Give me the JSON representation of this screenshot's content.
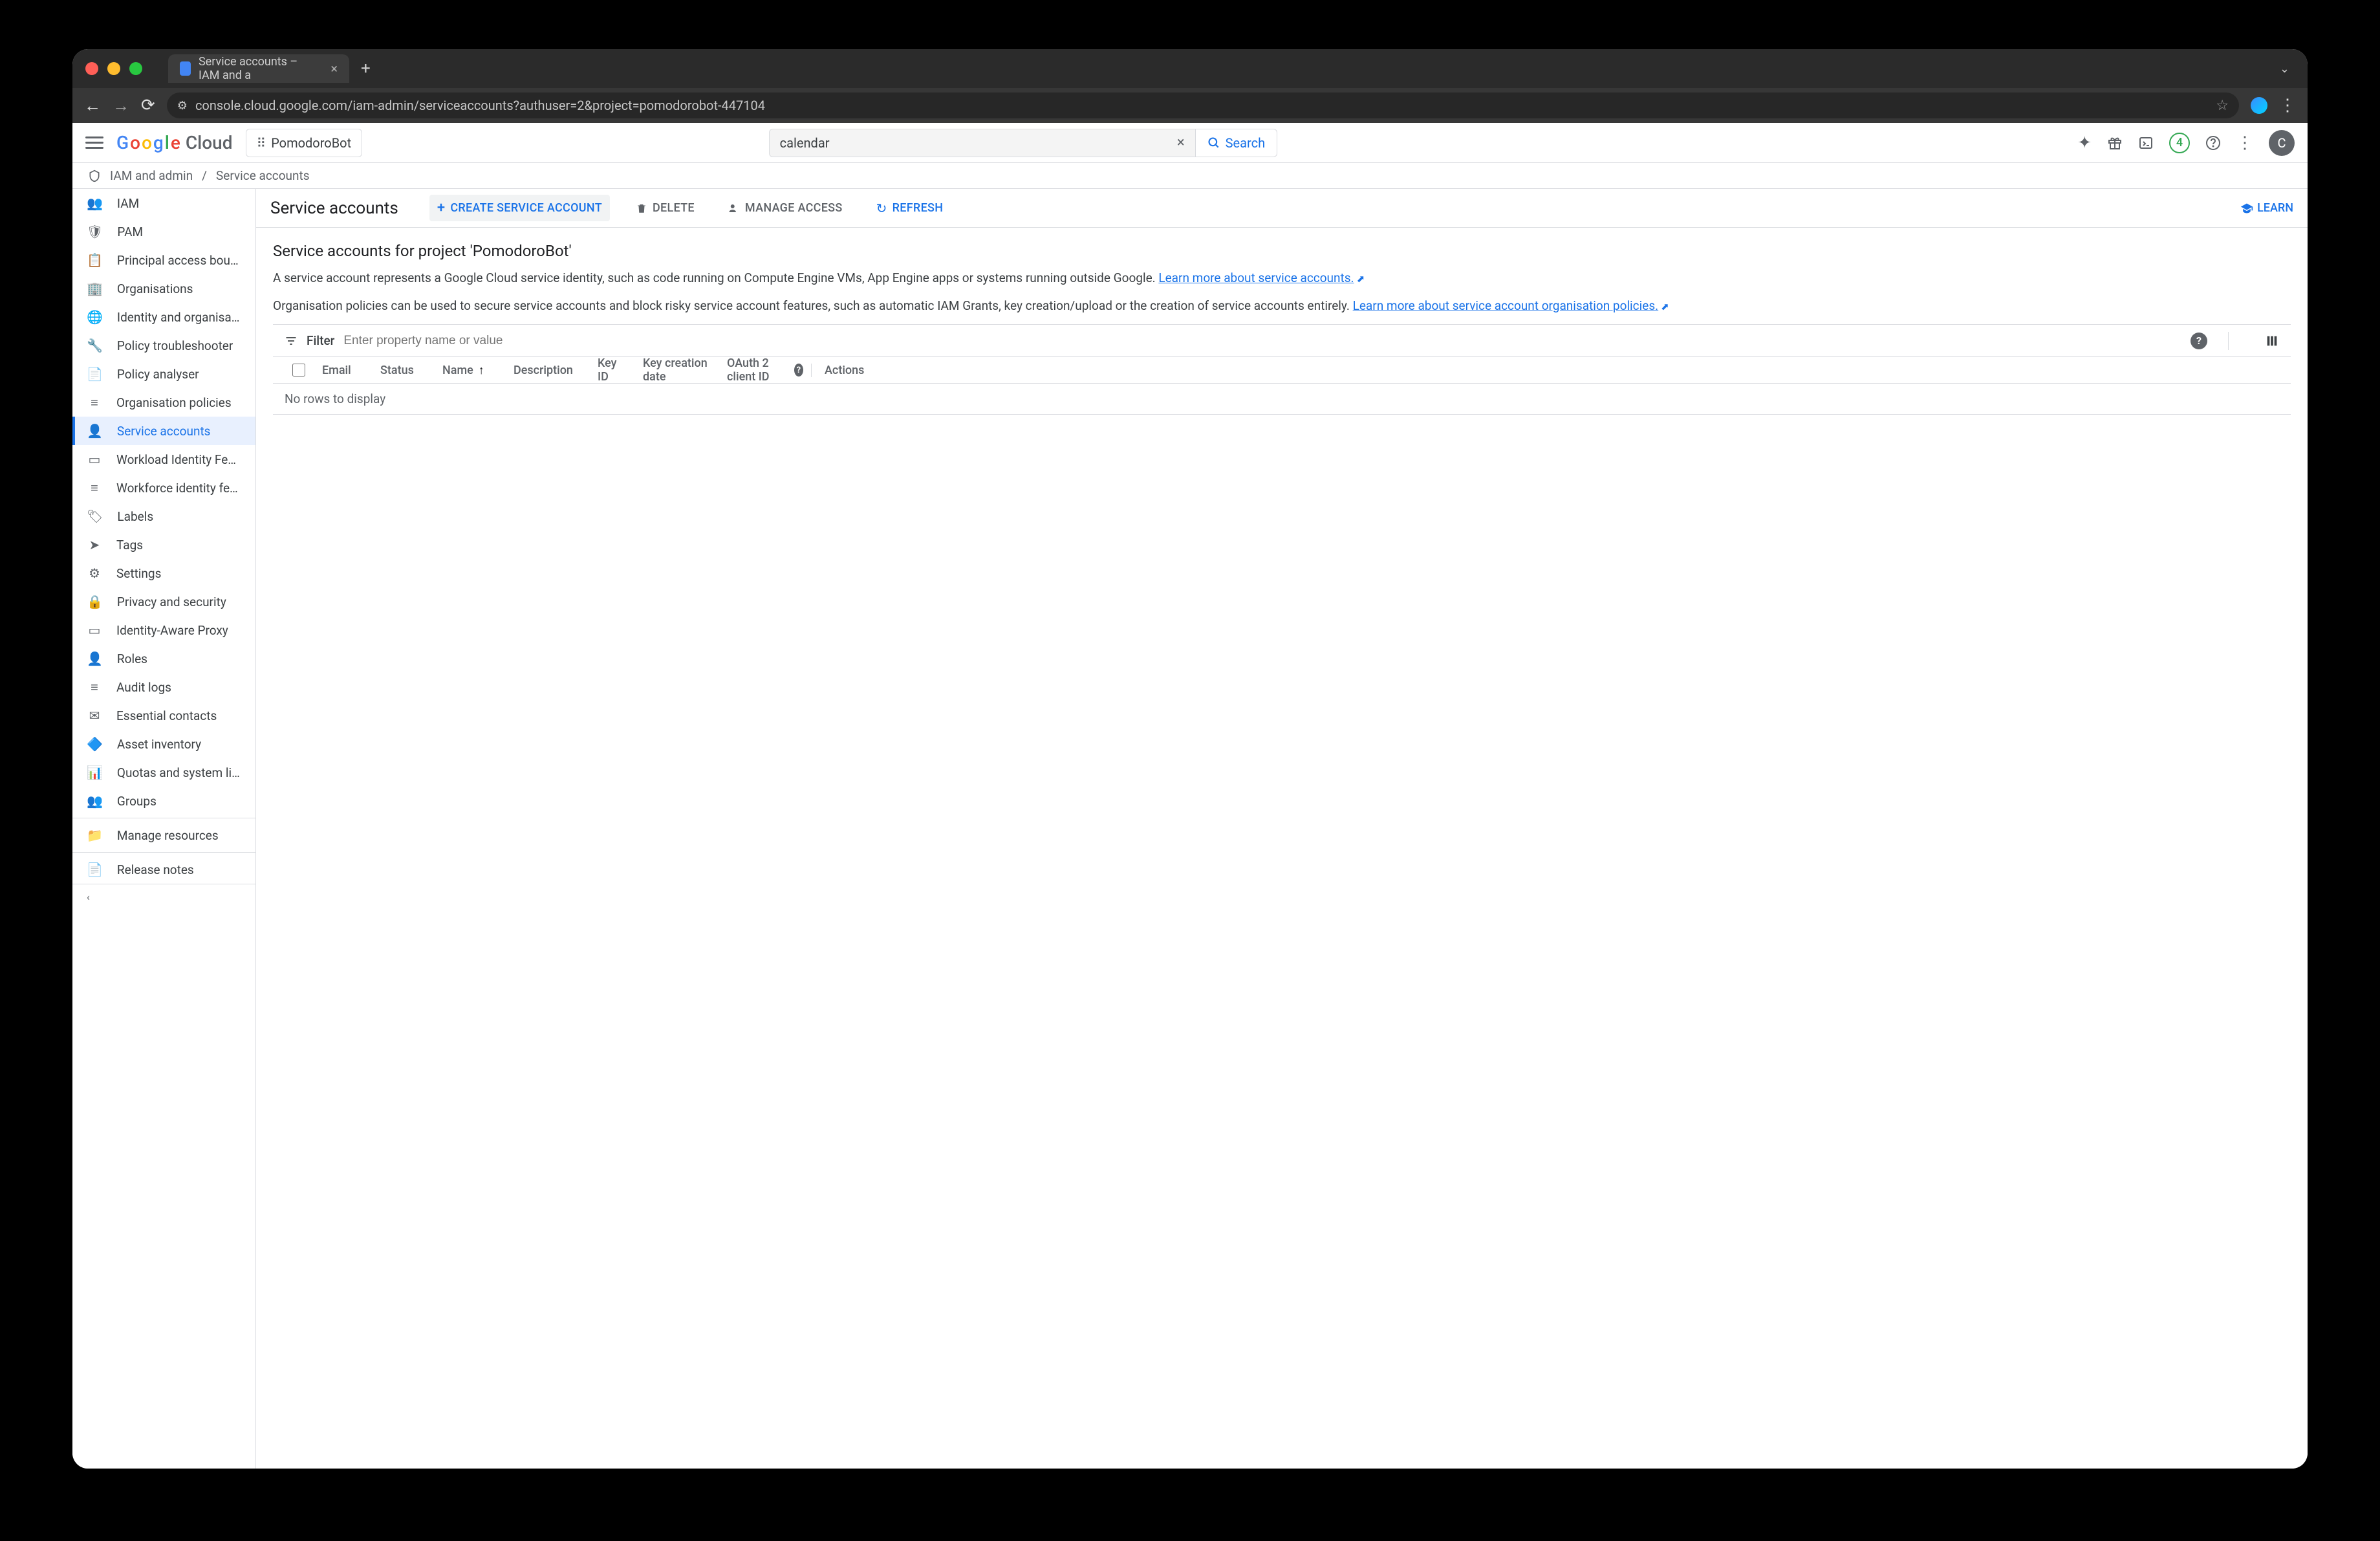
{
  "browser": {
    "tab_title": "Service accounts – IAM and a",
    "url": "console.cloud.google.com/iam-admin/serviceaccounts?authuser=2&project=pomodorobot-447104"
  },
  "header": {
    "logo_text": "Cloud",
    "project_name": "PomodoroBot",
    "search_value": "calendar",
    "search_button": "Search",
    "notif_count": "4",
    "avatar_letter": "C"
  },
  "breadcrumb": {
    "section": "IAM and admin",
    "page": "Service accounts"
  },
  "sidebar": {
    "items": [
      {
        "label": "IAM"
      },
      {
        "label": "PAM"
      },
      {
        "label": "Principal access bound..."
      },
      {
        "label": "Organisations"
      },
      {
        "label": "Identity and organisation"
      },
      {
        "label": "Policy troubleshooter"
      },
      {
        "label": "Policy analyser"
      },
      {
        "label": "Organisation policies"
      },
      {
        "label": "Service accounts"
      },
      {
        "label": "Workload Identity Fede..."
      },
      {
        "label": "Workforce identity fede..."
      },
      {
        "label": "Labels"
      },
      {
        "label": "Tags"
      },
      {
        "label": "Settings"
      },
      {
        "label": "Privacy and security"
      },
      {
        "label": "Identity-Aware Proxy"
      },
      {
        "label": "Roles"
      },
      {
        "label": "Audit logs"
      },
      {
        "label": "Essential contacts"
      },
      {
        "label": "Asset inventory"
      },
      {
        "label": "Quotas and system limi..."
      },
      {
        "label": "Groups"
      },
      {
        "label": "Manage resources"
      },
      {
        "label": "Release notes"
      }
    ]
  },
  "toolbar": {
    "title": "Service accounts",
    "create": "CREATE SERVICE ACCOUNT",
    "delete": "DELETE",
    "manage": "MANAGE ACCESS",
    "refresh": "REFRESH",
    "learn": "LEARN"
  },
  "content": {
    "heading": "Service accounts for project 'PomodoroBot'",
    "p1_a": "A service account represents a Google Cloud service identity, such as code running on Compute Engine VMs, App Engine apps or systems running outside Google. ",
    "p1_link": "Learn more about service accounts.",
    "p2_a": "Organisation policies can be used to secure service accounts and block risky service account features, such as automatic IAM Grants, key creation/upload or the creation of service accounts entirely. ",
    "p2_link": "Learn more about service account organisation policies."
  },
  "filter": {
    "label": "Filter",
    "placeholder": "Enter property name or value"
  },
  "table": {
    "cols": {
      "email": "Email",
      "status": "Status",
      "name": "Name",
      "desc": "Description",
      "keyid": "Key ID",
      "keydate": "Key creation date",
      "oauth": "OAuth 2 client ID",
      "actions": "Actions"
    },
    "empty": "No rows to display"
  }
}
